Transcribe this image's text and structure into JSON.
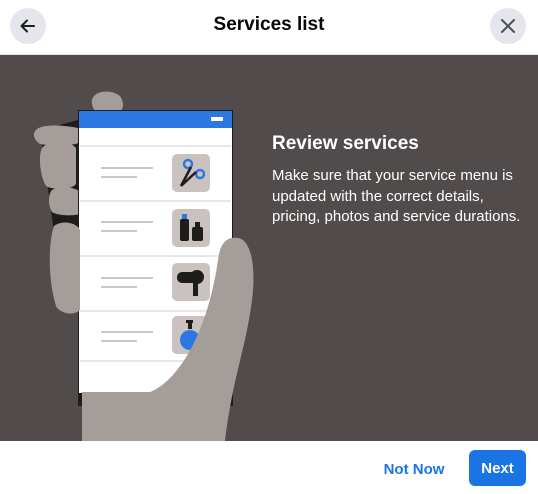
{
  "header": {
    "title": "Services list",
    "back_icon": "arrow-left-icon",
    "close_icon": "close-icon"
  },
  "hero": {
    "heading": "Review services",
    "description": "Make sure that your service menu is updated with the correct details, pricing, photos and service durations.",
    "illustration_icons": [
      "scissors-icon",
      "cosmetics-icon",
      "hair-dryer-icon",
      "soap-bottle-icon"
    ],
    "background_color": "#524b4b"
  },
  "footer": {
    "not_now_label": "Not Now",
    "next_label": "Next"
  },
  "colors": {
    "accent": "#1b74e4",
    "icon_button_bg": "#e4e6eb"
  }
}
